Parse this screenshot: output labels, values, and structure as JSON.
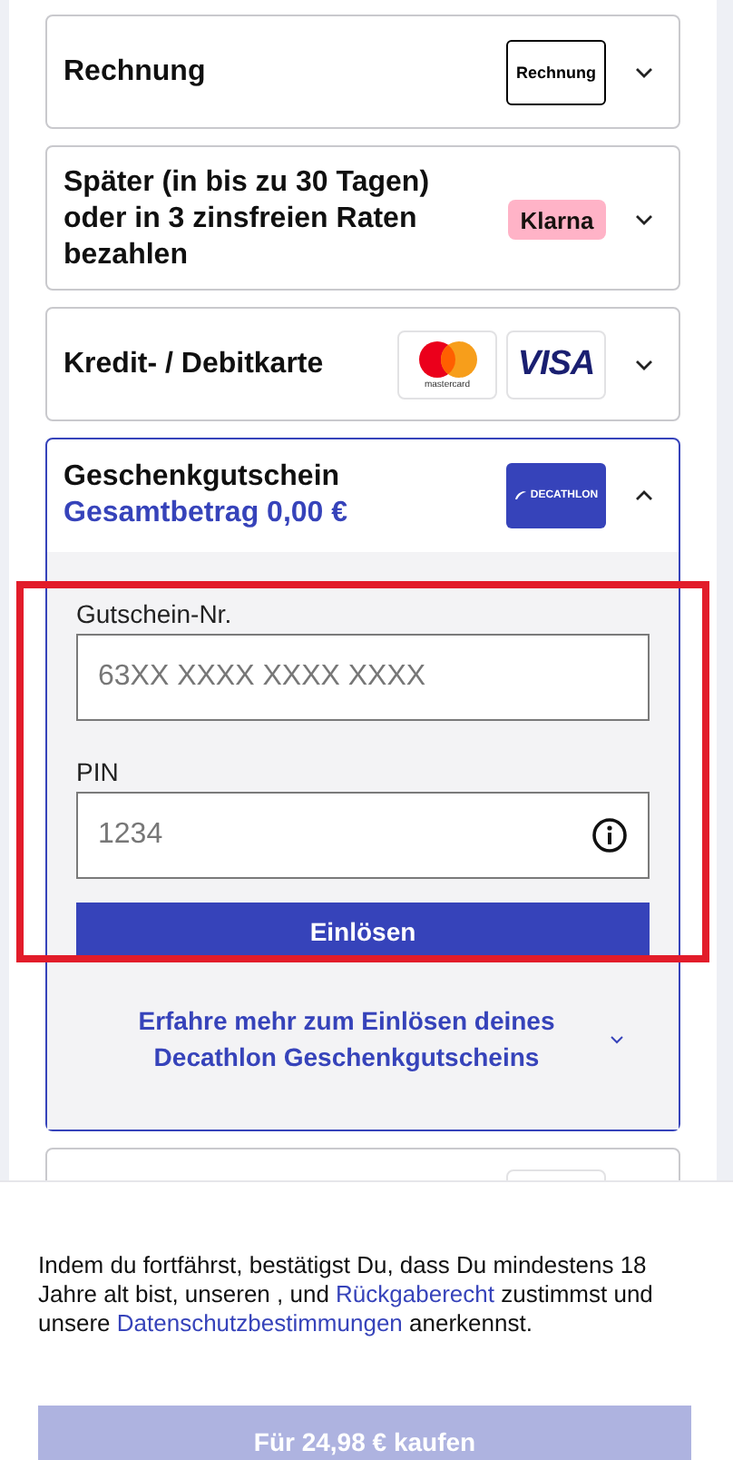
{
  "payment_methods": [
    {
      "kind": "invoice",
      "title": "Rechnung",
      "logo_text": "Rechnung",
      "expanded": false
    },
    {
      "kind": "klarna",
      "title": "Später (in bis zu 30 Tagen) oder in 3 zinsfreien Raten bezahlen",
      "logo_text": "Klarna",
      "expanded": false
    },
    {
      "kind": "cards",
      "title": "Kredit- / Debitkarte",
      "mastercard_caption": "mastercard",
      "visa_text": "VISA",
      "expanded": false
    },
    {
      "kind": "giftcard",
      "title": "Geschenkgutschein",
      "subtitle": "Gesamtbetrag 0,00 €",
      "logo_text": "DECATHLON",
      "expanded": true,
      "highlighted": true,
      "fields": [
        {
          "label": "Gutschein-Nr.",
          "placeholder": "63XX XXXX XXXX XXXX",
          "info": false
        },
        {
          "label": "PIN",
          "placeholder": "1234",
          "info": true
        }
      ],
      "button": "Einlösen",
      "info_link": {
        "text": "Erfahre mehr zum Einlösen deines Decathlon Geschenkgutscheins",
        "expanded": false
      }
    },
    {
      "kind": "wallet"
    }
  ],
  "footer": {
    "consent": [
      {
        "kind": "text",
        "text": "Indem du fortfährst, bestätigst Du, dass Du mindestens 18 Jahre alt bist, unseren , und "
      },
      {
        "kind": "link",
        "text": "Rückgaberecht"
      },
      {
        "kind": "text",
        "text": " zustimmst und unsere "
      },
      {
        "kind": "link",
        "text": "Datenschutzbestimmungen"
      },
      {
        "kind": "text",
        "text": " anerkennst."
      }
    ],
    "buy_button": {
      "text": "Für 24,98 € kaufen",
      "disabled": true
    }
  }
}
